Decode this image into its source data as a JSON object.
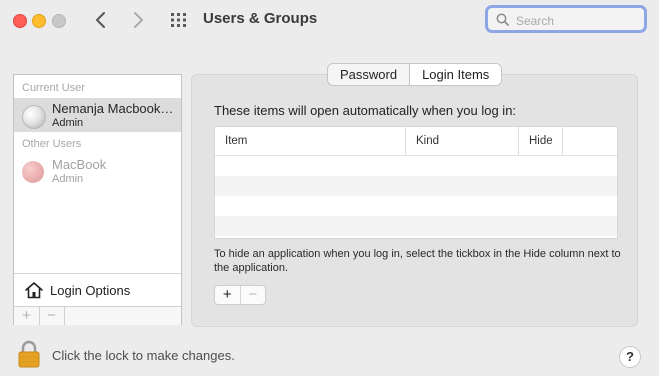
{
  "window": {
    "title": "Users & Groups",
    "search": {
      "placeholder": "Search",
      "value": ""
    }
  },
  "sidebar": {
    "current_user_heading": "Current User",
    "current_user": {
      "name": "Nemanja Macbook…",
      "role": "Admin"
    },
    "other_users_heading": "Other Users",
    "other_users": [
      {
        "name": "MacBook",
        "role": "Admin"
      }
    ],
    "login_options_label": "Login Options",
    "add_label": "+",
    "remove_label": "−"
  },
  "tabs": [
    {
      "label": "Password",
      "active": false
    },
    {
      "label": "Login Items",
      "active": true
    }
  ],
  "login_items": {
    "intro": "These items will open automatically when you log in:",
    "columns": [
      "Item",
      "Kind",
      "Hide"
    ],
    "rows": [],
    "hint": "To hide an application when you log in, select the tickbox in the Hide column next to the application.",
    "add_label": "+",
    "remove_label": "−"
  },
  "footer": {
    "lock_text": "Click the lock to make changes.",
    "help_label": "?"
  },
  "icons": {
    "back": "chevron-left-icon",
    "forward": "chevron-right-icon",
    "grid": "grid-icon",
    "search": "search-icon",
    "home": "home-icon",
    "lock": "lock-icon"
  },
  "colors": {
    "close": "#fe5f57",
    "minimize": "#febc2e",
    "zoom": "#c8c8c8",
    "search_focus_ring": "#8ea6e6",
    "selected_row": "#dcdcdc",
    "lock": "#e6a323"
  }
}
